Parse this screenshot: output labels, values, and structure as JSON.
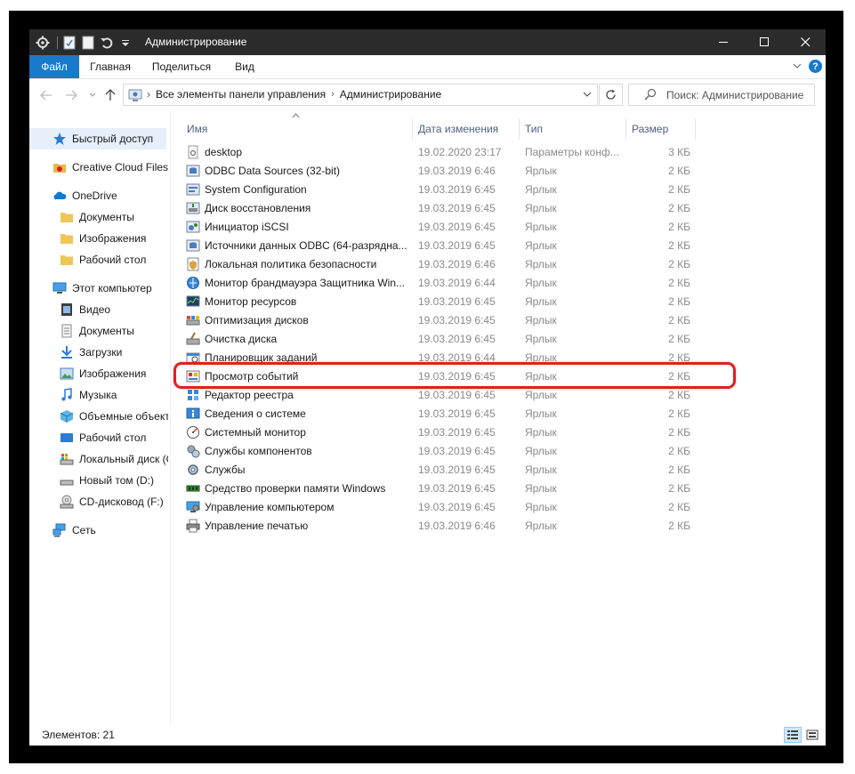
{
  "window": {
    "title": "Администрирование",
    "minimize_glyph": "─",
    "maximize_glyph": "☐",
    "close_glyph": "✕"
  },
  "ribbon": {
    "tabs": [
      {
        "label": "Файл",
        "active": true
      },
      {
        "label": "Главная"
      },
      {
        "label": "Поделиться"
      },
      {
        "label": "Вид"
      }
    ],
    "help_glyph": "?"
  },
  "address": {
    "crumbs": [
      "Все элементы панели управления",
      "Администрирование"
    ],
    "separator": "›"
  },
  "search": {
    "placeholder": "Поиск: Администрирование"
  },
  "sidebar": {
    "items": [
      {
        "label": "Быстрый доступ",
        "icon": "star-icon",
        "level": 0,
        "selected": true
      },
      {
        "label": "Creative Cloud Files",
        "icon": "creative-cloud-icon",
        "level": 0
      },
      {
        "label": "OneDrive",
        "icon": "cloud-icon",
        "level": 0
      },
      {
        "label": "Документы",
        "icon": "folder-icon",
        "level": 1
      },
      {
        "label": "Изображения",
        "icon": "folder-icon",
        "level": 1
      },
      {
        "label": "Рабочий стол",
        "icon": "folder-icon",
        "level": 1
      },
      {
        "label": "Этот компьютер",
        "icon": "computer-icon",
        "level": 0
      },
      {
        "label": "Видео",
        "icon": "video-icon",
        "level": 1
      },
      {
        "label": "Документы",
        "icon": "documents-icon",
        "level": 1
      },
      {
        "label": "Загрузки",
        "icon": "download-icon",
        "level": 1
      },
      {
        "label": "Изображения",
        "icon": "pictures-icon",
        "level": 1
      },
      {
        "label": "Музыка",
        "icon": "music-icon",
        "level": 1
      },
      {
        "label": "Объемные объект",
        "icon": "3d-objects-icon",
        "level": 1
      },
      {
        "label": "Рабочий стол",
        "icon": "desktop-icon",
        "level": 1
      },
      {
        "label": "Локальный диск (C",
        "icon": "system-drive-icon",
        "level": 1
      },
      {
        "label": "Новый том (D:)",
        "icon": "drive-icon",
        "level": 1
      },
      {
        "label": "CD-дисковод (F:)",
        "icon": "cd-drive-icon",
        "level": 1
      },
      {
        "label": "Сеть",
        "icon": "network-icon",
        "level": 0
      }
    ]
  },
  "columns": {
    "name": "Имя",
    "date": "Дата изменения",
    "type": "Тип",
    "size": "Размер"
  },
  "files": [
    {
      "name": "desktop",
      "date": "19.02.2020 23:17",
      "type": "Параметры конф...",
      "size": "3 КБ",
      "icon": "settings-file-icon"
    },
    {
      "name": "ODBC Data Sources (32-bit)",
      "date": "19.03.2019 6:46",
      "type": "Ярлык",
      "size": "2 КБ",
      "icon": "odbc-icon"
    },
    {
      "name": "System Configuration",
      "date": "19.03.2019 6:45",
      "type": "Ярлык",
      "size": "2 КБ",
      "icon": "system-configuration-icon"
    },
    {
      "name": "Диск восстановления",
      "date": "19.03.2019 6:45",
      "type": "Ярлык",
      "size": "2 КБ",
      "icon": "recovery-drive-icon"
    },
    {
      "name": "Инициатор iSCSI",
      "date": "19.03.2019 6:45",
      "type": "Ярлык",
      "size": "2 КБ",
      "icon": "iscsi-icon"
    },
    {
      "name": "Источники данных ODBC (64-разрядна...",
      "date": "19.03.2019 6:45",
      "type": "Ярлык",
      "size": "2 КБ",
      "icon": "odbc-icon"
    },
    {
      "name": "Локальная политика безопасности",
      "date": "19.03.2019 6:46",
      "type": "Ярлык",
      "size": "2 КБ",
      "icon": "security-policy-icon"
    },
    {
      "name": "Монитор брандмауэра Защитника Win...",
      "date": "19.03.2019 6:44",
      "type": "Ярлык",
      "size": "2 КБ",
      "icon": "firewall-icon"
    },
    {
      "name": "Монитор ресурсов",
      "date": "19.03.2019 6:45",
      "type": "Ярлык",
      "size": "2 КБ",
      "icon": "resource-monitor-icon"
    },
    {
      "name": "Оптимизация дисков",
      "date": "19.03.2019 6:45",
      "type": "Ярлык",
      "size": "2 КБ",
      "icon": "defrag-icon"
    },
    {
      "name": "Очистка диска",
      "date": "19.03.2019 6:45",
      "type": "Ярлык",
      "size": "2 КБ",
      "icon": "disk-cleanup-icon"
    },
    {
      "name": "Планировщик заданий",
      "date": "19.03.2019 6:44",
      "type": "Ярлык",
      "size": "2 КБ",
      "icon": "task-scheduler-icon"
    },
    {
      "name": "Просмотр событий",
      "date": "19.03.2019 6:45",
      "type": "Ярлык",
      "size": "2 КБ",
      "icon": "event-viewer-icon",
      "highlighted": true
    },
    {
      "name": "Редактор реестра",
      "date": "19.03.2019 6:45",
      "type": "Ярлык",
      "size": "2 КБ",
      "icon": "registry-editor-icon"
    },
    {
      "name": "Сведения о системе",
      "date": "19.03.2019 6:45",
      "type": "Ярлык",
      "size": "2 КБ",
      "icon": "system-info-icon"
    },
    {
      "name": "Системный монитор",
      "date": "19.03.2019 6:45",
      "type": "Ярлык",
      "size": "2 КБ",
      "icon": "performance-monitor-icon"
    },
    {
      "name": "Службы компонентов",
      "date": "19.03.2019 6:45",
      "type": "Ярлык",
      "size": "2 КБ",
      "icon": "component-services-icon"
    },
    {
      "name": "Службы",
      "date": "19.03.2019 6:45",
      "type": "Ярлык",
      "size": "2 КБ",
      "icon": "services-icon"
    },
    {
      "name": "Средство проверки памяти Windows",
      "date": "19.03.2019 6:45",
      "type": "Ярлык",
      "size": "2 КБ",
      "icon": "memory-diagnostic-icon"
    },
    {
      "name": "Управление компьютером",
      "date": "19.03.2019 6:45",
      "type": "Ярлык",
      "size": "2 КБ",
      "icon": "computer-management-icon"
    },
    {
      "name": "Управление печатью",
      "date": "19.03.2019 6:46",
      "type": "Ярлык",
      "size": "2 КБ",
      "icon": "print-management-icon"
    }
  ],
  "status": {
    "count_text": "Элементов: 21"
  },
  "colors": {
    "file_tab": "#1979ca",
    "titlebar": "#2b2b2b",
    "highlight": "#e02020",
    "column_header_text": "#4d6082",
    "secondary_text": "#8a8a8a",
    "selected_nav": "#e5f0fb"
  }
}
